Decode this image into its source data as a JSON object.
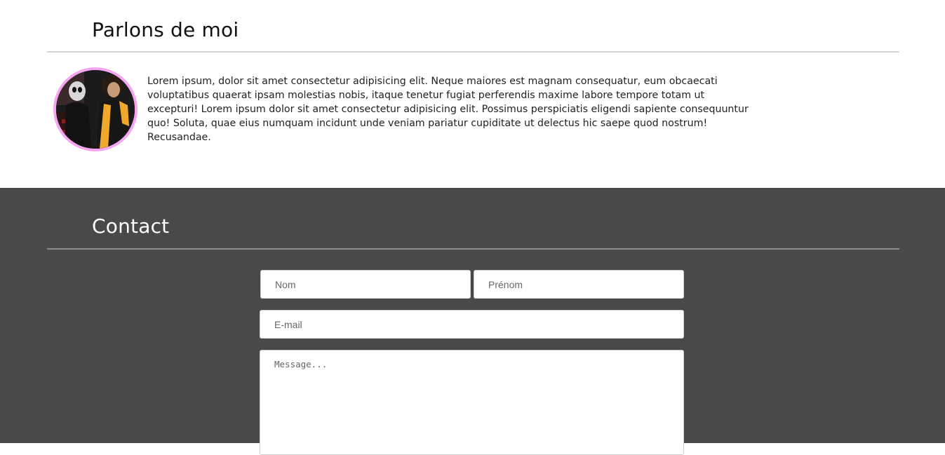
{
  "about": {
    "title": "Parlons de moi",
    "bio": "Lorem ipsum, dolor sit amet consectetur adipisicing elit. Neque maiores est magnam consequatur, eum obcaecati voluptatibus quaerat ipsam molestias nobis, itaque tenetur fugiat perferendis maxime labore tempore totam ut excepturi! Lorem ipsum dolor sit amet consectetur adipisicing elit. Possimus perspiciatis eligendi sapiente consequuntur quo! Soluta, quae eius numquam incidunt unde veniam pariatur cupiditate ut delectus hic saepe quod nostrum! Recusandae."
  },
  "contact": {
    "title": "Contact",
    "form": {
      "nom_placeholder": "Nom",
      "prenom_placeholder": "Prénom",
      "email_placeholder": "E-mail",
      "message_placeholder": "Message..."
    }
  },
  "colors": {
    "contact_background": "#494949",
    "avatar_border": "#f4a6f0"
  }
}
